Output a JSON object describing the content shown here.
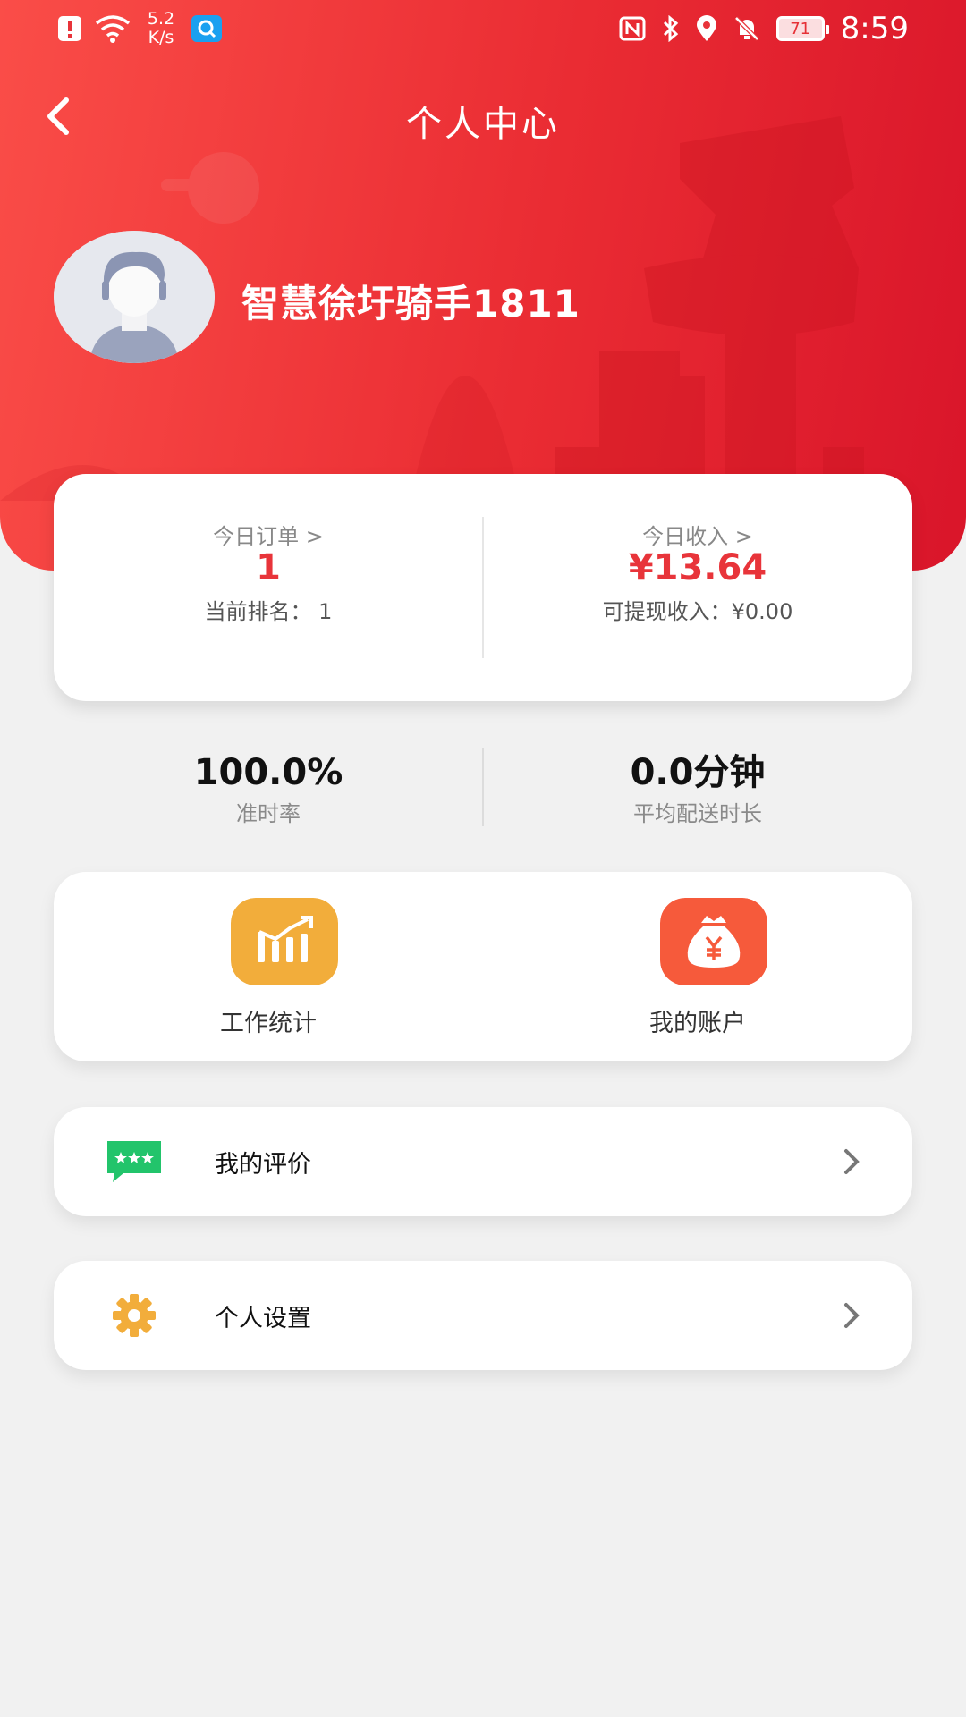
{
  "status_bar": {
    "net_speed_value": "5.2",
    "net_speed_unit": "K/s",
    "battery": "71",
    "time": "8:59"
  },
  "header": {
    "title": "个人中心",
    "back_icon": "chevron-left-icon",
    "username": "智慧徐圩骑手1811"
  },
  "stats": {
    "orders_label": "今日订单 >",
    "orders_value": "1",
    "rank_text": "当前排名： 1",
    "income_label": "今日收入 >",
    "income_value": "¥13.64",
    "withdrawable_text": "可提现收入：¥0.00",
    "accent_color": "#e8343a"
  },
  "metrics": {
    "ontime_value": "100.0%",
    "ontime_label": "准时率",
    "avg_value": "0.0分钟",
    "avg_label": "平均配送时长"
  },
  "actions": [
    {
      "label": "工作统计",
      "icon": "bar-chart-icon",
      "color": "#f2ad3b"
    },
    {
      "label": "我的账户",
      "icon": "money-bag-icon",
      "color": "#f65a3b"
    }
  ],
  "menu": [
    {
      "label": "我的评价",
      "icon": "review-chat-icon",
      "color": "#22c46b"
    },
    {
      "label": "个人设置",
      "icon": "gear-icon",
      "color": "#f2ad3b"
    }
  ]
}
